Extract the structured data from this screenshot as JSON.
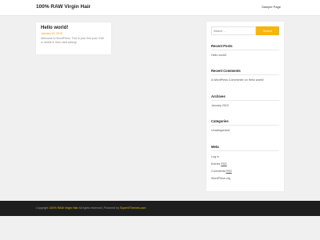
{
  "header": {
    "site_title": "100% RAW Virgin Hair",
    "nav_item": "Sample Page"
  },
  "post": {
    "title": "Hello world!",
    "date": "January 19, 2019",
    "excerpt": "Welcome to WordPress. This is your first post. Edit or delete it, then start writing!"
  },
  "sidebar": {
    "search_placeholder": "Search …",
    "search_button": "Search",
    "recent_posts": {
      "title": "Recent Posts",
      "items": [
        "Hello world!"
      ]
    },
    "recent_comments": {
      "title": "Recent Comments",
      "author": "A WordPress Commenter",
      "connector": " on ",
      "post": "Hello world!"
    },
    "archives": {
      "title": "Archives",
      "items": [
        "January 2019"
      ]
    },
    "categories": {
      "title": "Categories",
      "items": [
        "Uncategorized"
      ]
    },
    "meta": {
      "title": "Meta",
      "login": "Log in",
      "entries_prefix": "Entries ",
      "entries_rss": "RSS",
      "comments_prefix": "Comments ",
      "comments_rss": "RSS",
      "wordpress": "WordPress.org"
    }
  },
  "footer": {
    "copyright_prefix": "Copyright ",
    "site_link": "100% RAW Virgin Hair",
    "rights_text": " All rights reserved | Powered by ",
    "theme_link": "SuperbThemes.com"
  },
  "colors": {
    "accent": "#f5b50a",
    "footer_background": "#1e1e1e",
    "page_background": "#f0f0f0"
  }
}
